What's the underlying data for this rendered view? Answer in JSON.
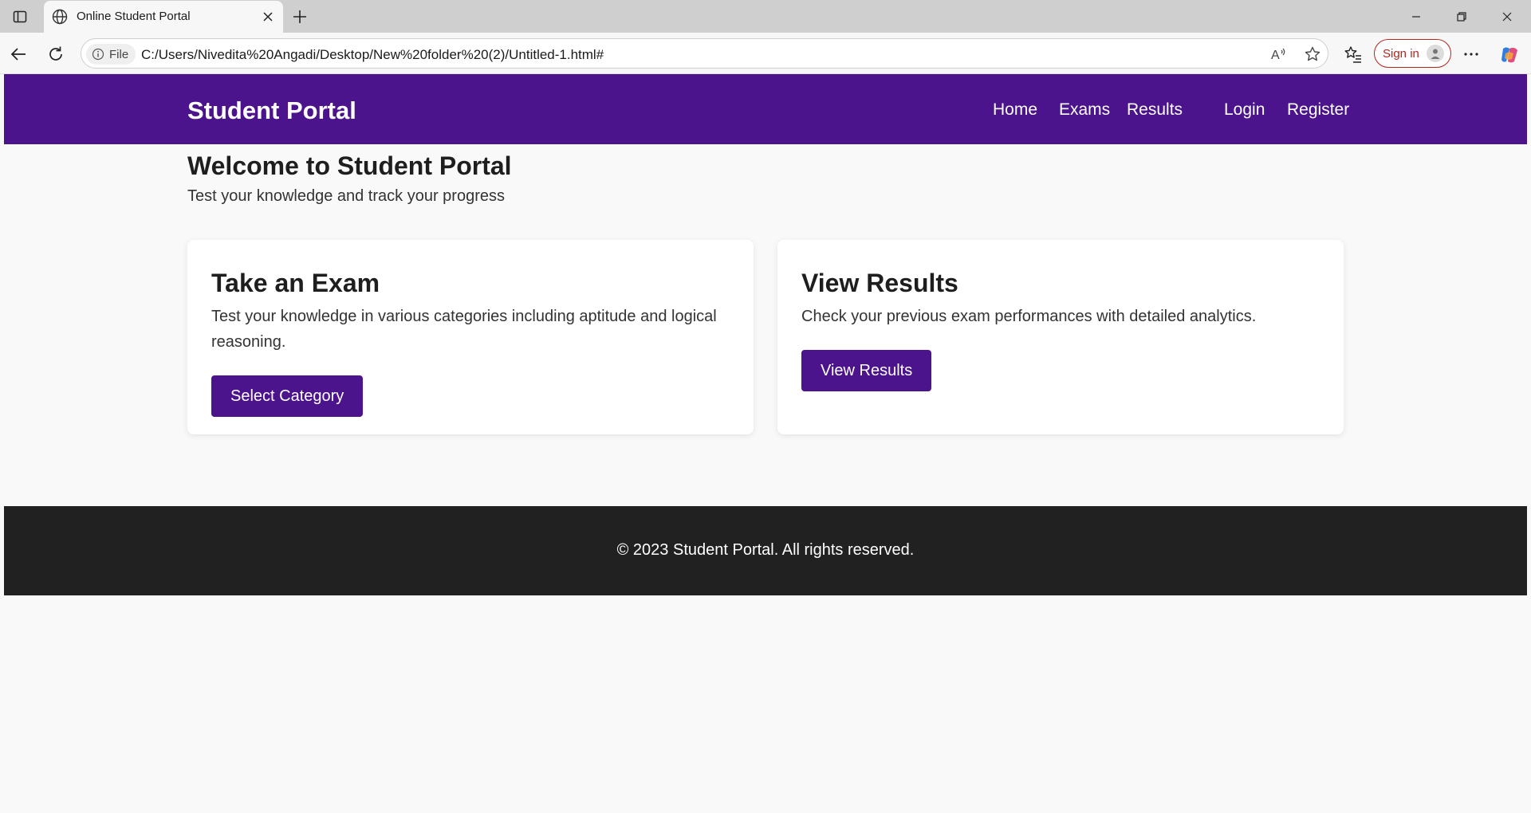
{
  "browser": {
    "tab_title": "Online Student Portal",
    "file_chip": "File",
    "url": "C:/Users/Nivedita%20Angadi/Desktop/New%20folder%20(2)/Untitled-1.html#",
    "sign_in": "Sign in",
    "icons": [
      "sidebar-icon",
      "globe-icon",
      "close-icon",
      "plus-icon",
      "minimize-icon",
      "restore-icon",
      "back-arrow-icon",
      "reload-icon",
      "info-icon",
      "read-aloud-icon",
      "star-icon",
      "favorites-icon",
      "profile-icon",
      "more-icon",
      "copilot-icon"
    ]
  },
  "site": {
    "brand": "Student Portal",
    "nav": {
      "home": "Home",
      "exams": "Exams",
      "results": "Results",
      "login": "Login",
      "register": "Register"
    },
    "colors": {
      "primary": "#4c148c",
      "footer": "#212121",
      "background": "#f9f9f9"
    }
  },
  "main": {
    "title": "Welcome to Student Portal",
    "subtitle": "Test your knowledge and track your progress",
    "cards": {
      "exam": {
        "title": "Take an Exam",
        "desc": "Test your knowledge in various categories including aptitude and logical reasoning.",
        "button": "Select Category"
      },
      "results": {
        "title": "View Results",
        "desc": "Check your previous exam performances with detailed analytics.",
        "button": "View Results"
      }
    }
  },
  "footer": {
    "text": "© 2023 Student Portal. All rights reserved."
  }
}
